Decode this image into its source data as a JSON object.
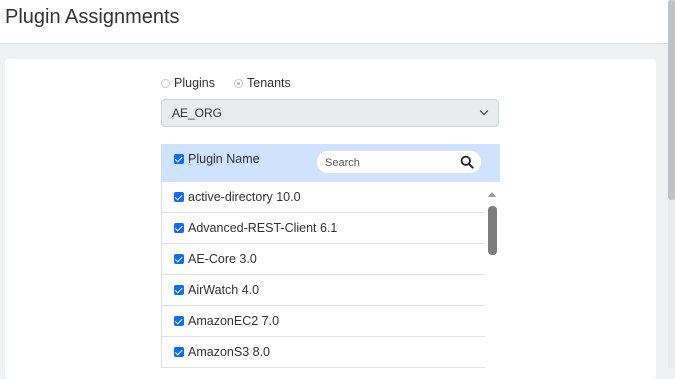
{
  "page": {
    "title": "Plugin Assignments"
  },
  "mode": {
    "options": [
      {
        "label": "Plugins",
        "checked": false
      },
      {
        "label": "Tenants",
        "checked": true
      }
    ]
  },
  "tenant_select": {
    "value": "AE_ORG"
  },
  "list": {
    "header_label": "Plugin Name",
    "search_placeholder": "Search",
    "items": [
      {
        "label": "active-directory 10.0",
        "checked": true
      },
      {
        "label": "Advanced-REST-Client 6.1",
        "checked": true
      },
      {
        "label": "AE-Core 3.0",
        "checked": true
      },
      {
        "label": "AirWatch 4.0",
        "checked": true
      },
      {
        "label": "AmazonEC2 7.0",
        "checked": true
      },
      {
        "label": "AmazonS3 8.0",
        "checked": true
      }
    ]
  },
  "colors": {
    "accent": "#0d6efd",
    "header_bg": "#cfe2ff"
  }
}
